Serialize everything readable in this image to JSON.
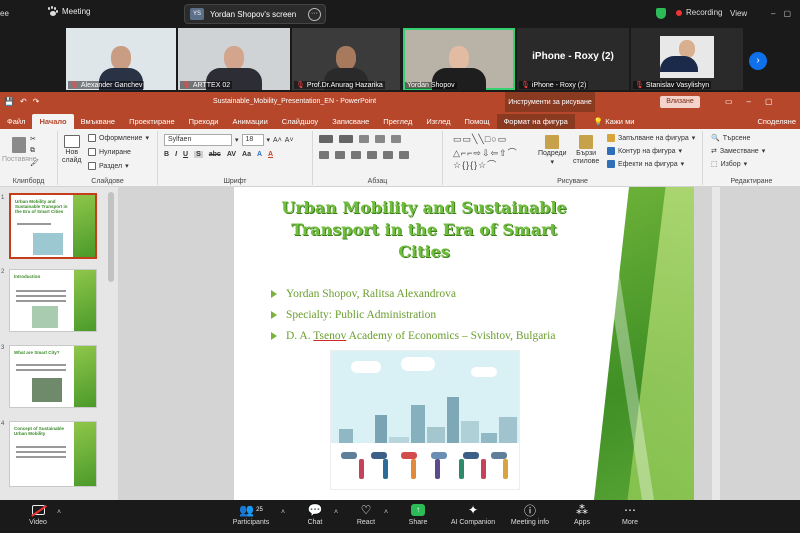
{
  "zoom": {
    "meeting_label": "Meeting",
    "left_fragment": "ee",
    "share_pill": {
      "initials": "YS",
      "text": "Yordan Shopov's screen"
    },
    "recording_label": "Recording",
    "view_label": "View",
    "participants": [
      {
        "name": "Alexander Ganchev",
        "muted": true
      },
      {
        "name": "ARTTEX 02",
        "muted": true
      },
      {
        "name": "Prof.Dr.Anurag Hazarika",
        "muted": true
      },
      {
        "name": "Yordan Shopov",
        "muted": false,
        "active": true
      },
      {
        "name": "iPhone - Roxy (2)",
        "muted": true,
        "big_label": "iPhone - Roxy (2)"
      },
      {
        "name": "Stanislav Vasylishyn",
        "muted": true
      }
    ],
    "toolbar": {
      "video": "Video",
      "participants": "Participants",
      "participants_count": "25",
      "chat": "Chat",
      "react": "React",
      "share": "Share",
      "ai": "AI Companion",
      "meeting_info": "Meeting info",
      "apps": "Apps",
      "more": "More"
    }
  },
  "ppt": {
    "title": "Sustainable_Mobility_Presentation_EN  -  PowerPoint",
    "drawing_tools": "Инструменти за рисуване",
    "signin": "Влизане",
    "tabs": [
      "Файл",
      "Начало",
      "Вмъкване",
      "Проектиране",
      "Преходи",
      "Анимации",
      "Слайдшоу",
      "Записване",
      "Преглед",
      "Изглед",
      "Помощ",
      "Формат на фигура"
    ],
    "tellme": "Кажи ми",
    "share": "Споделяне",
    "ribbon": {
      "clipboard": "Клипборд",
      "paste": "Поставяне",
      "slides": "Слайдове",
      "new_slide_1": "Нов",
      "new_slide_2": "слайд",
      "layout": "Оформление",
      "reset": "Нулиране",
      "section": "Раздел",
      "font_group": "Шрифт",
      "font_name": "Sylfaen",
      "font_size": "18",
      "paragraph": "Абзац",
      "drawing": "Рисуване",
      "arrange": "Подреди",
      "quick_styles_1": "Бързи",
      "quick_styles_2": "стилове",
      "fill": "Запълване на фигура",
      "outline": "Контур на фигура",
      "effects": "Ефекти на фигура",
      "editing": "Редактиране",
      "find": "Търсене",
      "replace": "Заместване",
      "select": "Избор"
    },
    "thumbnails": [
      {
        "num": "1",
        "title": "Urban Mobility and Sustainable Transport in the Era of Smart Cities"
      },
      {
        "num": "2",
        "title": "Introduction"
      },
      {
        "num": "3",
        "title": "What are Smart City?"
      },
      {
        "num": "4",
        "title": "Concept of Sustainable Urban Mobility"
      }
    ],
    "slide": {
      "title_line1": "Urban Mobility and Sustainable",
      "title_line2": "Transport in the Era of Smart",
      "title_line3": "Cities",
      "bullet1": "Yordan Shopov, Ralitsa Alexandrova",
      "bullet2": "Specialty: Public Administration",
      "bullet3_pre": "D. A. ",
      "bullet3_ul": "Tsenov",
      "bullet3_post": " Academy of Economics – Svishtov, Bulgaria"
    }
  }
}
